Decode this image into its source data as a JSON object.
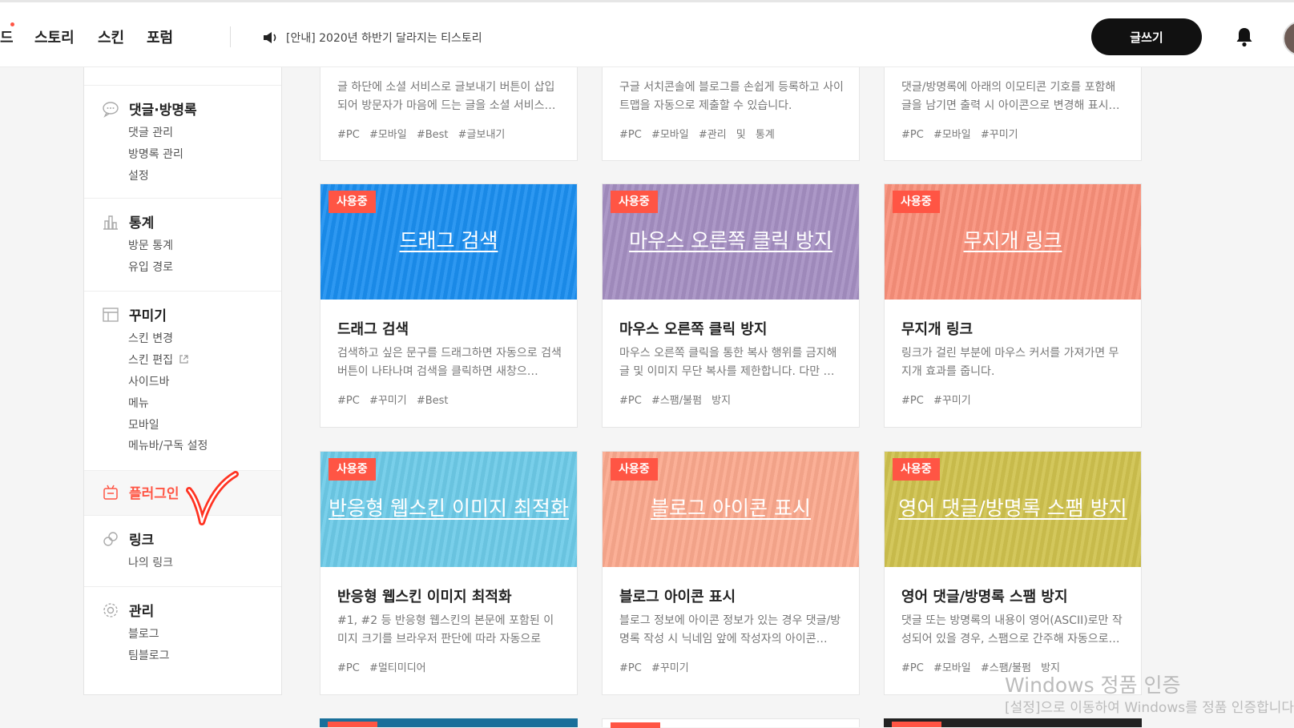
{
  "header": {
    "nav_partial": "드",
    "nav_story": "스토리",
    "nav_skin": "스킨",
    "nav_forum": "포럼",
    "notice": "[안내] 2020년 하반기 달라지는 티스토리",
    "write_button": "글쓰기"
  },
  "sidebar": {
    "comments": {
      "title": "댓글·방명록",
      "items": [
        "댓글 관리",
        "방명록 관리",
        "설정"
      ]
    },
    "stats": {
      "title": "통계",
      "items": [
        "방문 통계",
        "유입 경로"
      ]
    },
    "decorate": {
      "title": "꾸미기",
      "items": [
        "스킨 변경",
        "스킨 편집",
        "사이드바",
        "메뉴",
        "모바일",
        "메뉴바/구독 설정"
      ]
    },
    "plugin": {
      "title": "플러그인"
    },
    "link": {
      "title": "링크",
      "items": [
        "나의 링크"
      ]
    },
    "manage": {
      "title": "관리",
      "items": [
        "블로그",
        "팀블로그"
      ]
    }
  },
  "cards_top": [
    {
      "desc": "글 하단에 소셜 서비스로 글보내기 버튼이 삽입되어 방문자가 마음에 드는 글을 소셜 서비스…",
      "tags": "#PC #모바일 #Best #글보내기"
    },
    {
      "desc": "구글 서치콘솔에 블로그를 손쉽게 등록하고 사이트맵을 자동으로 제출할 수 있습니다.",
      "tags": "#PC #모바일 #관리 및 통계"
    },
    {
      "desc": "댓글/방명록에 아래의 이모티콘 기호를 포함해 글을 남기면 출력 시 아이콘으로 변경해 표시…",
      "tags": "#PC #모바일 #꾸미기"
    }
  ],
  "cards": [
    {
      "badge": "사용중",
      "thumb_title": "드래그 검색",
      "title": "드래그 검색",
      "desc": "검색하고 싶은 문구를 드래그하면 자동으로 검색 버튼이 나타나며 검색을 클릭하면 새창으…",
      "tags": "#PC #꾸미기 #Best",
      "color": "#1b8ff0"
    },
    {
      "badge": "사용중",
      "thumb_title": "마우스 오른쪽 클릭 방지",
      "title": "마우스 오른쪽 클릭 방지",
      "desc": "마우스 오른쪽 클릭을 통한 복사 행위를 금지해 글 및 이미지 무단 복사를 제한합니다. 다만 …",
      "tags": "#PC #스팸/불펌 방지",
      "color": "#a58fc2"
    },
    {
      "badge": "사용중",
      "thumb_title": "무지개 링크",
      "title": "무지개 링크",
      "desc": "링크가 걸린 부분에 마우스 커서를 가져가면 무지개 효과를 줍니다.",
      "tags": "#PC #꾸미기",
      "color": "#f9907a"
    },
    {
      "badge": "사용중",
      "thumb_title": "반응형 웹스킨 이미지 최적화",
      "title": "반응형 웹스킨 이미지 최적화",
      "desc": "#1, #2 등 반응형 웹스킨의 본문에 포함된 이미지 크기를 브라우저 판단에 따라 자동으로 조…",
      "tags": "#PC #멀티미디어",
      "color": "#6dcbe8"
    },
    {
      "badge": "사용중",
      "thumb_title": "블로그 아이콘 표시",
      "title": "블로그 아이콘 표시",
      "desc": "블로그 정보에 아이콘 정보가 있는 경우 댓글/방명록 작성 시 닉네임 앞에 작성자의 아이콘…",
      "tags": "#PC #꾸미기",
      "color": "#fba98e"
    },
    {
      "badge": "사용중",
      "thumb_title": "영어 댓글/방명록 스팸 방지",
      "title": "영어 댓글/방명록 스팸 방지",
      "desc": "댓글 또는 방명록의 내용이 영어(ASCII)로만 작성되어 있을 경우, 스팸으로 간주해 자동으로…",
      "tags": "#PC #모바일 #스팸/불펌 방지",
      "color": "#cfc24e"
    }
  ],
  "watermark": {
    "line1": "Windows 정품 인증",
    "line2": "[설정]으로 이동하여 Windows를 정품 인증합니다."
  }
}
